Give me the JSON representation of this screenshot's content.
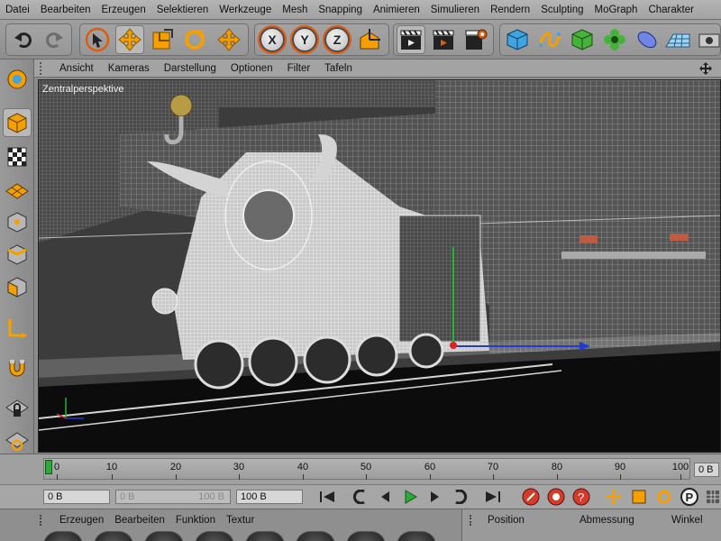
{
  "menubar": {
    "items": [
      "Datei",
      "Bearbeiten",
      "Erzeugen",
      "Selektieren",
      "Werkzeuge",
      "Mesh",
      "Snapping",
      "Animieren",
      "Simulieren",
      "Rendern",
      "Sculpting",
      "MoGraph",
      "Charakter"
    ]
  },
  "toolbar": {
    "axis_x": "X",
    "axis_y": "Y",
    "axis_z": "Z"
  },
  "viewport": {
    "menu": [
      "Ansicht",
      "Kameras",
      "Darstellung",
      "Optionen",
      "Filter",
      "Tafeln"
    ],
    "label": "Zentralperspektive"
  },
  "timeline": {
    "ticks": [
      "0",
      "10",
      "20",
      "30",
      "40",
      "50",
      "60",
      "70",
      "80",
      "90",
      "100"
    ],
    "current_frame": "0 B"
  },
  "transport": {
    "start_field": "0 B",
    "min_field": "0 B",
    "max_field": "100 B",
    "end_field": "100 B"
  },
  "material_panel": {
    "menu": [
      "Erzeugen",
      "Bearbeiten",
      "Funktion",
      "Textur"
    ]
  },
  "coordinates_panel": {
    "headers": [
      "Position",
      "Abmessung",
      "Winkel"
    ]
  },
  "colors": {
    "accent": "#e05a10",
    "selection_green": "#2eaa39"
  }
}
